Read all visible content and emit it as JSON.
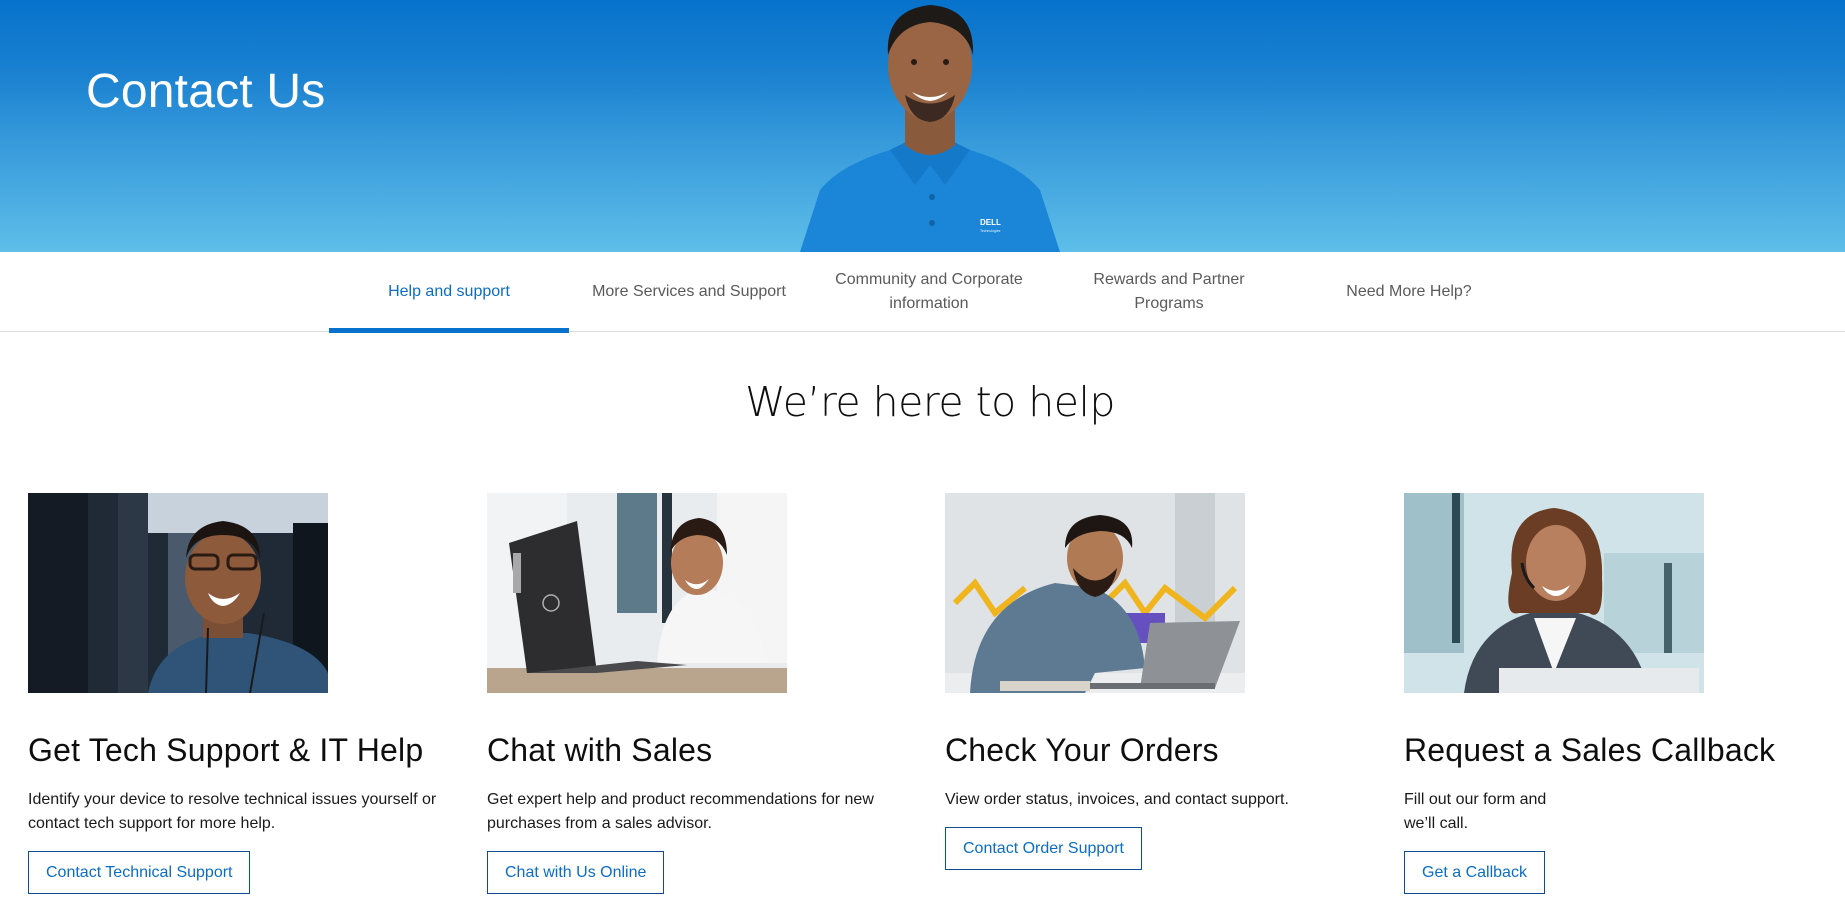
{
  "hero": {
    "title": "Contact Us",
    "image": "smiling-support-agent-in-blue-polo",
    "shirt_logo": "DELL",
    "shirt_logo_sub": "Technologies"
  },
  "tabs": [
    {
      "label": "Help and support",
      "active": true
    },
    {
      "label": "More Services and Support",
      "active": false
    },
    {
      "label": "Community and Corporate information",
      "active": false
    },
    {
      "label": "Rewards and Partner Programs",
      "active": false
    },
    {
      "label": "Need More Help?",
      "active": false
    }
  ],
  "main": {
    "heading": "We’re here to help",
    "cards": [
      {
        "image": "smiling-man-in-data-center",
        "title": "Get Tech Support & IT Help",
        "description": "Identify your device to resolve technical issues yourself or contact tech support for more help.",
        "button": "Contact Technical Support"
      },
      {
        "image": "woman-using-laptop-at-desk",
        "title": "Chat with Sales",
        "description": "Get expert help and product recommendations for new purchases from a sales advisor.",
        "button": "Chat with Us Online"
      },
      {
        "image": "man-working-on-laptop-in-office",
        "title": "Check Your Orders",
        "description": "View order status, invoices, and contact support.",
        "button": "Contact Order Support"
      },
      {
        "image": "woman-with-headset-smiling",
        "title": "Request a Sales Callback",
        "description_lines": [
          "Fill out our form and",
          "we’ll call."
        ],
        "button": "Get a Callback"
      }
    ]
  },
  "colors": {
    "brand_blue": "#0672cb",
    "link_blue": "#0b6ec3",
    "button_border": "#0e4d8f",
    "tab_text": "#5a5a5a"
  }
}
